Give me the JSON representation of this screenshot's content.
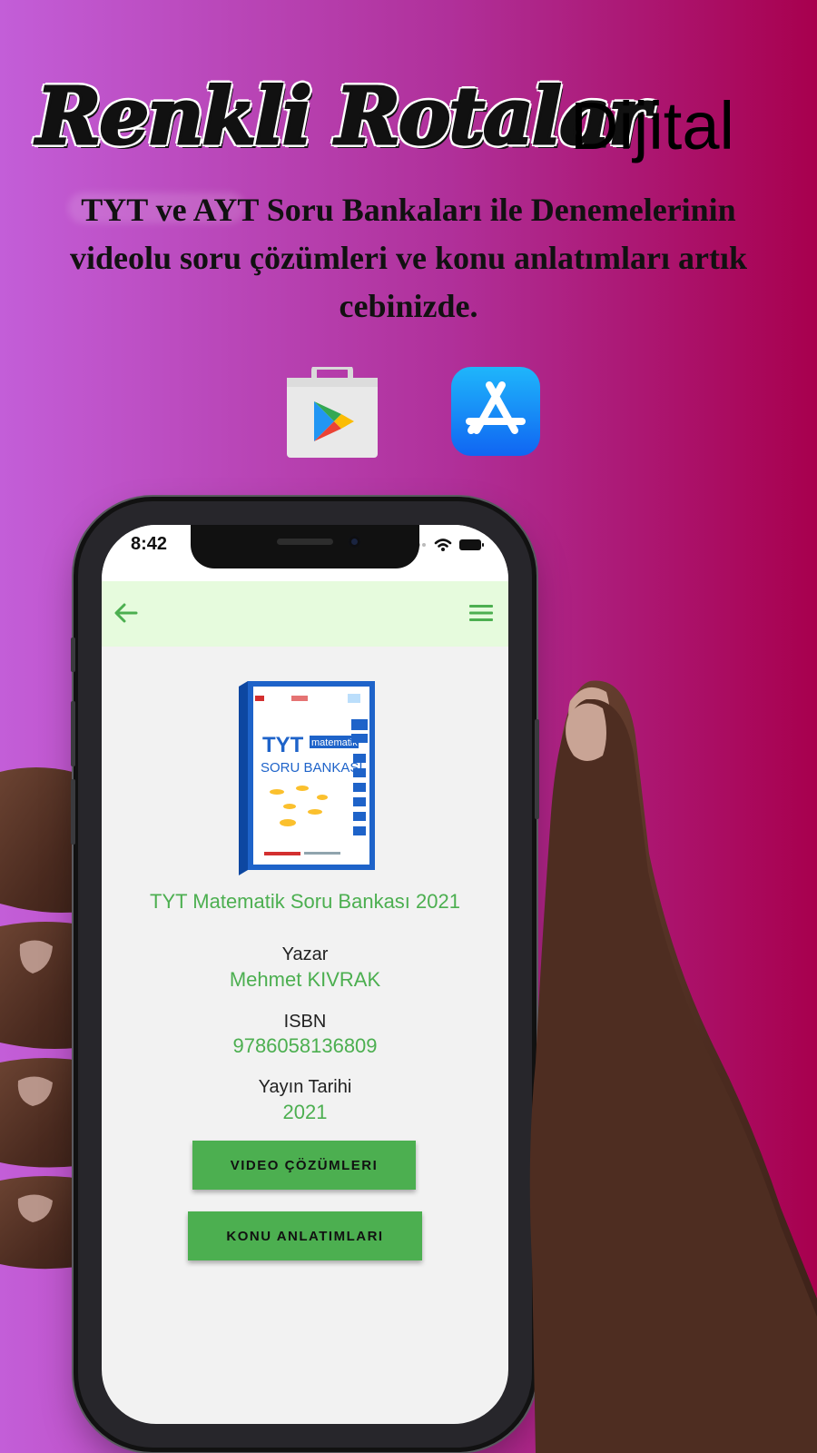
{
  "promo": {
    "brand": "Renkli Rotalar",
    "brand_suffix": "Dijital",
    "tagline": "TYT ve AYT Soru Bankaları ile Denemelerinin videolu soru çözümleri ve konu anlatımları artık cebinizde."
  },
  "stores": [
    {
      "icon": "google-play-icon"
    },
    {
      "icon": "app-store-icon"
    }
  ],
  "status_bar": {
    "time": "8:42"
  },
  "app_bar": {
    "back_icon": "arrow-left-icon",
    "menu_icon": "hamburger-menu-icon",
    "color": "#e6fbdd"
  },
  "book": {
    "cover": {
      "badge": "TYT",
      "subject": "matematik",
      "series": "SORU BANKASI"
    },
    "title": "TYT Matematik Soru Bankası 2021",
    "author_label": "Yazar",
    "author": "Mehmet KIVRAK",
    "isbn_label": "ISBN",
    "isbn": "9786058136809",
    "date_label": "Yayın Tarihi",
    "date": "2021"
  },
  "actions": {
    "video_label": "VIDEO ÇÖZÜMLERI",
    "lecture_label": "KONU ANLATIMLARI"
  },
  "colors": {
    "accent_green": "#4caf50",
    "background_start": "#c35ed8",
    "background_end": "#a8004e"
  }
}
